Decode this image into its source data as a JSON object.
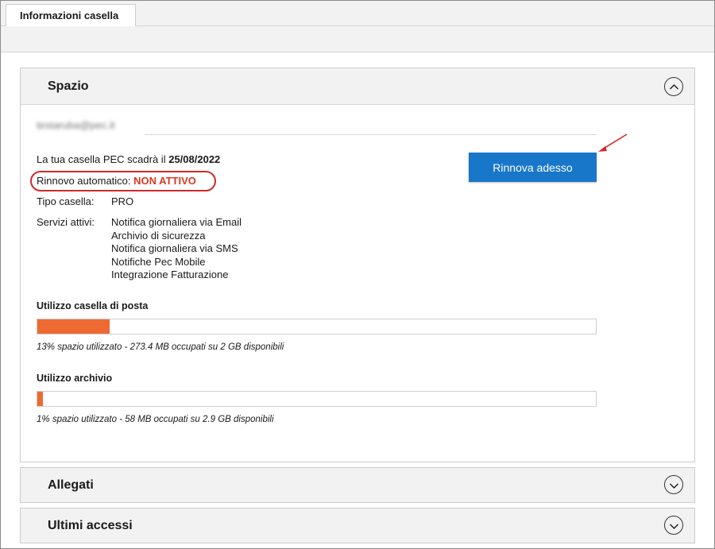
{
  "tabs": [
    {
      "label": "Informazioni casella",
      "active": true
    }
  ],
  "spazio": {
    "title": "Spazio",
    "email": "testaruba@pec.it",
    "expiry_prefix": "La tua casella PEC scadrà il",
    "expiry_date": "25/08/2022",
    "renewal_label": "Rinnovo automatico:",
    "renewal_status": "NON ATTIVO",
    "renew_button": "Rinnova adesso",
    "type_label": "Tipo casella:",
    "type_value": "PRO",
    "services_label": "Servizi attivi:",
    "services": [
      "Notifica giornaliera via Email",
      "Archivio di sicurezza",
      "Notifica giornaliera via SMS",
      "Notifiche Pec Mobile",
      "Integrazione Fatturazione"
    ],
    "mailbox_usage": {
      "label": "Utilizzo casella di posta",
      "percent": 13,
      "caption": "13% spazio utilizzato - 273.4 MB occupati su 2 GB disponibili"
    },
    "archive_usage": {
      "label": "Utilizzo archivio",
      "percent": 1,
      "caption": "1% spazio utilizzato - 58 MB occupati su 2.9 GB disponibili"
    }
  },
  "collapsed_sections": [
    {
      "title": "Allegati"
    },
    {
      "title": "Ultimi accessi"
    }
  ],
  "colors": {
    "accent_button": "#1877c9",
    "progress_fill": "#ee6a32",
    "warning_text": "#d63a1f",
    "highlight_ring": "#cc2a2a"
  },
  "icons": {
    "expanded": "chevron-up-icon",
    "collapsed": "chevron-down-icon",
    "callout": "red-arrow-icon"
  }
}
